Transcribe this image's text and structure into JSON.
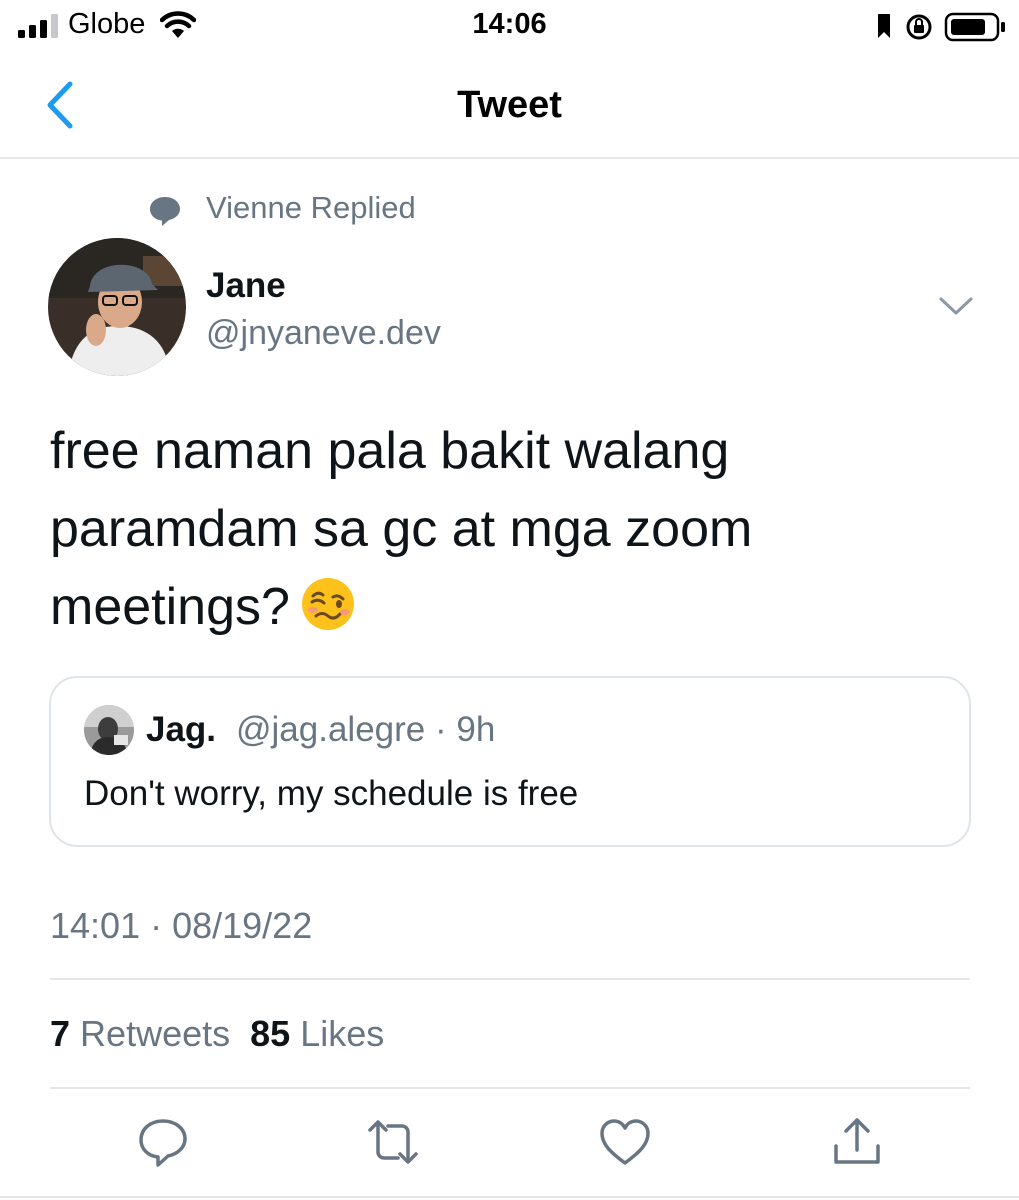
{
  "status_bar": {
    "carrier": "Globe",
    "time": "14:06"
  },
  "nav": {
    "title": "Tweet"
  },
  "social_context": {
    "text": "Vienne Replied"
  },
  "author": {
    "name": "Jane",
    "handle": "@jnyaneve.dev"
  },
  "tweet": {
    "text": "free naman pala bakit walang paramdam sa gc at mga zoom meetings?",
    "emoji": "woozy-face"
  },
  "quoted": {
    "name": "Jag.",
    "meta": "@jag.alegre · 9h",
    "text": "Don't worry, my schedule is free"
  },
  "timestamp": "14:01 · 08/19/22",
  "stats": {
    "retweets_count": "7",
    "retweets_label": "Retweets",
    "likes_count": "85",
    "likes_label": "Likes"
  },
  "colors": {
    "accent": "#1d9bf0",
    "secondary_text": "#687684",
    "divider": "#e6e6e6"
  }
}
